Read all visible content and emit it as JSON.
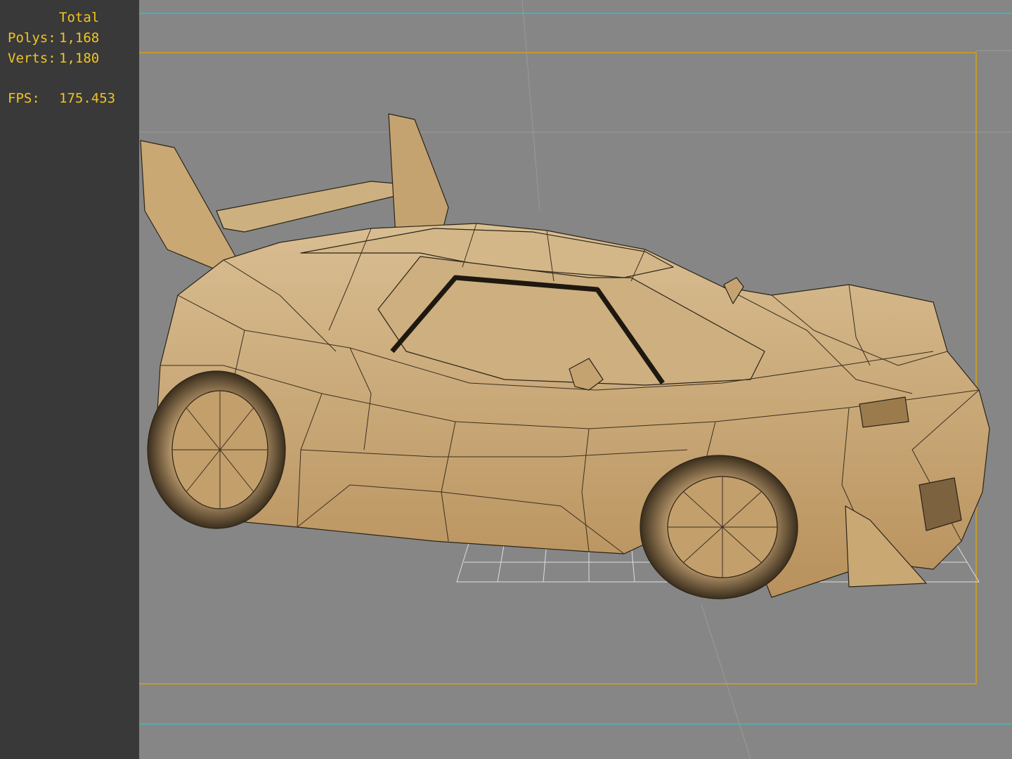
{
  "stats": {
    "column_header": "Total",
    "polys_label": "Polys:",
    "polys_value": "1,168",
    "verts_label": "Verts:",
    "verts_value": "1,180",
    "fps_label": "FPS:",
    "fps_value": "175.453"
  },
  "colors": {
    "stat_text": "#f2c51f",
    "panel_bg": "#393939",
    "viewport_bg": "#868686",
    "guide_line": "#3fb4b9",
    "safe_frame": "#c39a2f",
    "mesh_fill": "#c9a874",
    "mesh_edge": "#2b2418"
  }
}
